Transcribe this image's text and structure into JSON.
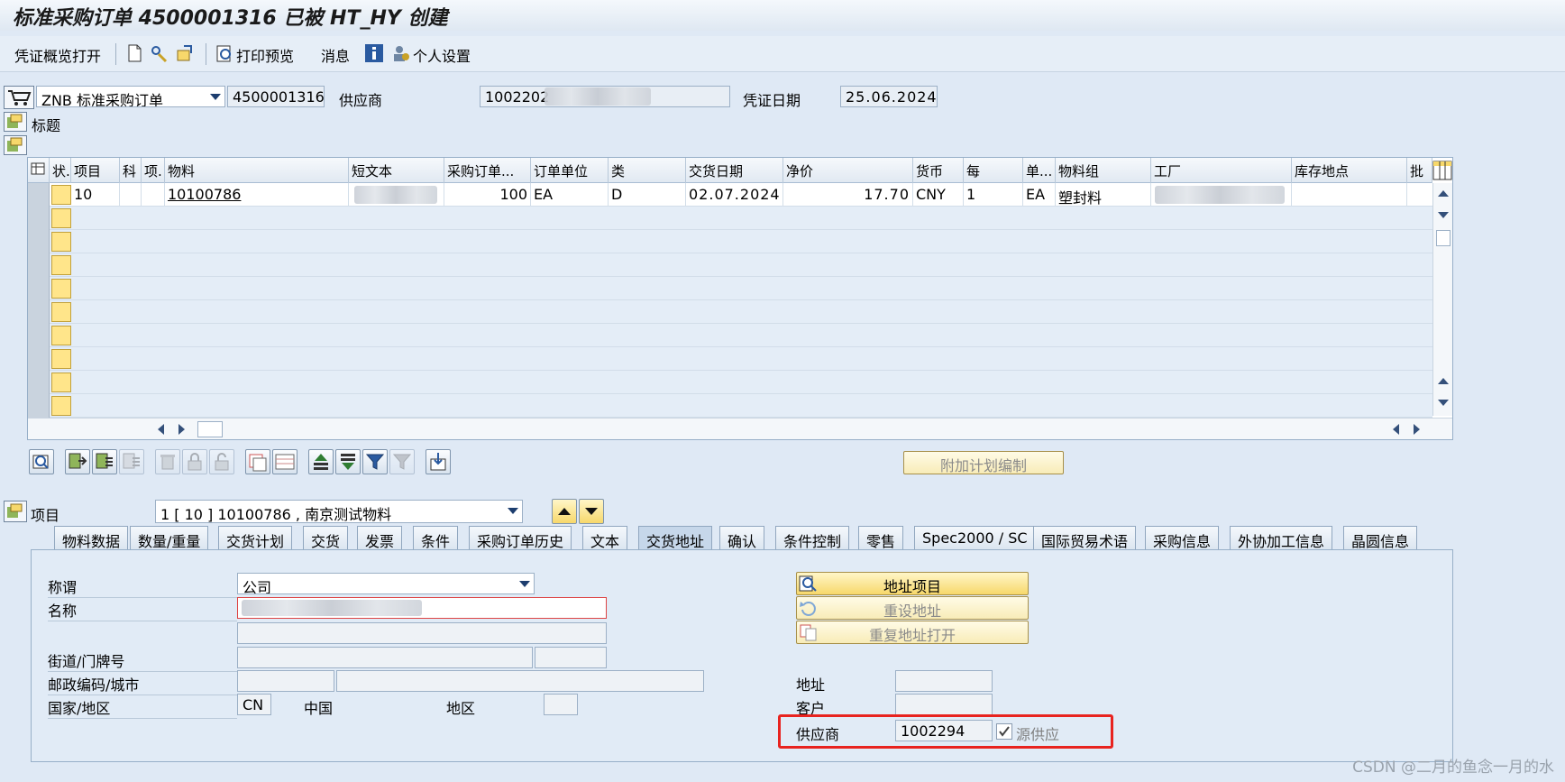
{
  "window": {
    "title": "标准采购订单 4500001316 已被 HT_HY 创建"
  },
  "toolbar": {
    "overview_label": "凭证概览打开",
    "print_preview_label": "打印预览",
    "messages_label": "消息",
    "personal_settings_label": "个人设置"
  },
  "header": {
    "doc_type": "ZNB 标准采购订单",
    "po_number": "4500001316",
    "vendor_label": "供应商",
    "vendor_value": "1002202",
    "doc_date_label": "凭证日期",
    "doc_date_value": "25.06.2024",
    "header_label": "标题"
  },
  "grid": {
    "columns": [
      "状.",
      "项目",
      "科",
      "项.",
      "物料",
      "短文本",
      "采购订单...",
      "订单单位",
      "类",
      "交货日期",
      "净价",
      "货币",
      "每",
      "单...",
      "物料组",
      "工厂",
      "库存地点",
      "批"
    ],
    "row": {
      "item": "10",
      "material": "10100786",
      "quantity": "100",
      "unit": "EA",
      "category": "D",
      "delivery_date": "02.07.2024",
      "net_price": "17.70",
      "currency": "CNY",
      "per": "1",
      "order_unit": "EA",
      "material_group": "塑封料"
    }
  },
  "buttons": {
    "schedule_label": "附加计划编制"
  },
  "item_selector": {
    "label": "项目",
    "value": "1 [ 10 ] 10100786 , 南京测试物料"
  },
  "tabs": [
    "物料数据",
    "数量/重量",
    "交货计划",
    "交货",
    "发票",
    "条件",
    "采购订单历史",
    "文本",
    "交货地址",
    "确认",
    "条件控制",
    "零售",
    "Spec2000 / SC",
    "国际贸易术语",
    "采购信息",
    "外协加工信息",
    "晶圆信息"
  ],
  "active_tab": "交货地址",
  "address": {
    "title_label": "称谓",
    "title_value": "公司",
    "name_label": "名称",
    "street_label": "街道/门牌号",
    "postal_label": "邮政编码/城市",
    "country_label": "国家/地区",
    "country_code": "CN",
    "country_name": "中国",
    "region_label": "地区",
    "address_item_btn": "地址项目",
    "reset_address_btn": "重设地址",
    "reopen_address_btn": "重复地址打开",
    "address_label": "地址",
    "customer_label": "客户",
    "supplier_label": "供应商",
    "supplier_value": "1002294",
    "source_supply_label": "源供应"
  },
  "watermark": "CSDN @二月的鱼念一月的水",
  "colors": {
    "highlight": "#e8231f",
    "button_yellow": "#f7d86b",
    "window_bg": "#dfe9f5"
  }
}
